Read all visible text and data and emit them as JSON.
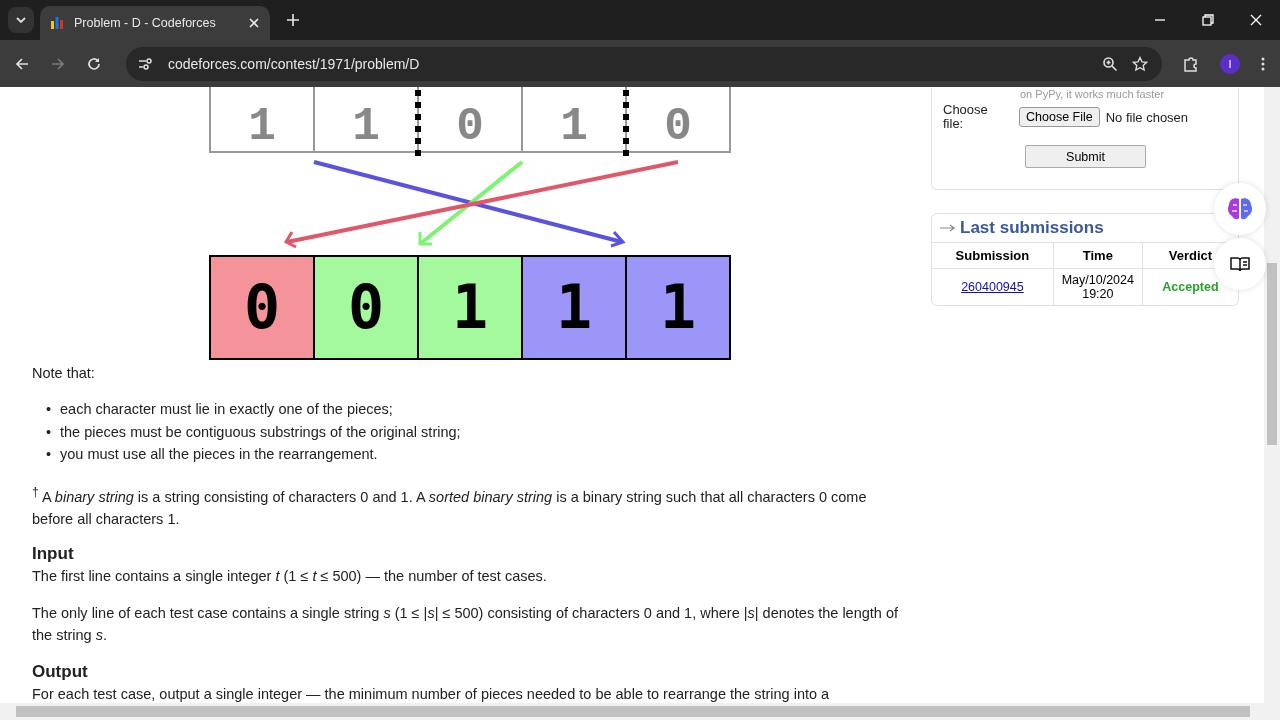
{
  "browser": {
    "tabs": [
      {
        "title": "Problem - D - Codeforces",
        "selected": true
      }
    ],
    "url": "codeforces.com/contest/1971/problem/D",
    "profile_initial": "I"
  },
  "diagram": {
    "top_cells": [
      {
        "digit": "1",
        "cut_after": false
      },
      {
        "digit": "1",
        "cut_after": true
      },
      {
        "digit": "0",
        "cut_after": false
      },
      {
        "digit": "1",
        "cut_after": true
      },
      {
        "digit": "0",
        "cut_after": false
      }
    ],
    "bottom_cells": [
      {
        "digit": "0",
        "color": "#f5939a"
      },
      {
        "digit": "0",
        "color": "#a3f99b"
      },
      {
        "digit": "1",
        "color": "#a3f99b"
      },
      {
        "digit": "1",
        "color": "#9c96f8"
      },
      {
        "digit": "1",
        "color": "#9c96f8"
      }
    ]
  },
  "note_intro": "Note that:",
  "notes": [
    {
      "bullet": "•",
      "text": "each character must lie in exactly one of the pieces;"
    },
    {
      "bullet": "•",
      "text": "the pieces must be contiguous substrings of the original string;"
    },
    {
      "bullet": "•",
      "text": "you must use all the pieces in the rearrangement."
    }
  ],
  "footnote": "$^{†}$ A *binary string* is a string consisting of characters 0 and 1. A *sorted binary string* is a binary string such that all characters 0 come before all characters 1.",
  "sections": [
    {
      "heading": "Input",
      "paragraphs": [
        "The first line contains a single integer *t* (1 ≤ *t* ≤ 500) — the number of test cases.",
        "The only line of each test case contains a single string *s* (1 ≤ |*s*| ≤ 500) consisting of characters 0 and 1, where |*s*| denotes the length of the string *s*."
      ]
    },
    {
      "heading": "Output",
      "paragraphs": [
        "For each test case, output a single integer — the minimum number of pieces needed to be able to rearrange the string into a"
      ]
    }
  ],
  "submit_form": {
    "hint": "on PyPy, it works much faster",
    "file_label": "Choose file:",
    "file_button": "Choose File",
    "file_status": "No file chosen",
    "submit": "Submit"
  },
  "last_submissions": {
    "title": "Last submissions",
    "columns": [
      "Submission",
      "Time",
      "Verdict"
    ],
    "rows": [
      {
        "submission": "260400945",
        "time": "May/10/2024 19:20",
        "verdict": "Accepted"
      }
    ]
  }
}
